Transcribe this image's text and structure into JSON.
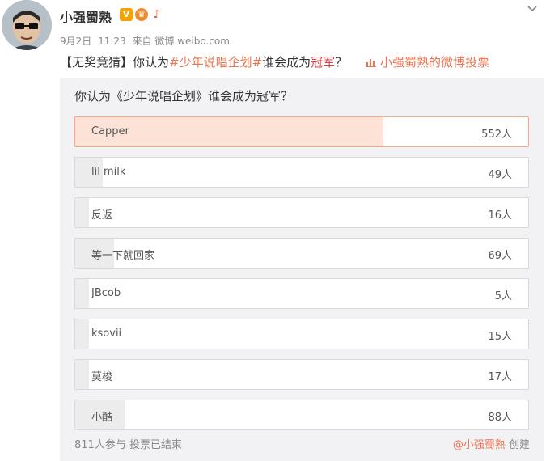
{
  "user": {
    "name": "小强蜀熟",
    "avatar_icon": "avatar-portrait",
    "badges": [
      "verified-v-icon",
      "medal-icon",
      "guitar-icon"
    ]
  },
  "meta": {
    "date": "9月2日",
    "time": "11:23",
    "source_prefix": "来自",
    "source": "微博 weibo.com"
  },
  "post": {
    "prefix": "【无奖竞猜】你认为",
    "hashtag": "#少年说唱企划#",
    "middle": "谁会成为",
    "red_word": "冠军",
    "suffix": "？",
    "vote_link_icon": "chart-icon",
    "vote_link": "小强蜀熟的微博投票"
  },
  "poll": {
    "title": "你认为《少年说唱企划》谁会成为冠军？",
    "options": [
      {
        "label": "Capper",
        "count": "552人",
        "votes": 552
      },
      {
        "label": "lil milk",
        "count": "49人",
        "votes": 49
      },
      {
        "label": "反返",
        "count": "16人",
        "votes": 16
      },
      {
        "label": "等一下就回家",
        "count": "69人",
        "votes": 69
      },
      {
        "label": "JBcob",
        "count": "5人",
        "votes": 5
      },
      {
        "label": "ksovii",
        "count": "15人",
        "votes": 15
      },
      {
        "label": "莫梭",
        "count": "17人",
        "votes": 17
      },
      {
        "label": "小酷",
        "count": "88人",
        "votes": 88
      }
    ],
    "participants": "811人参与",
    "status": "投票已结束",
    "author": "@小强蜀熟",
    "created": "创建"
  },
  "colors": {
    "accent": "#eb7350",
    "top_fill": "#fde3d7",
    "bar_fill": "#ececec"
  }
}
